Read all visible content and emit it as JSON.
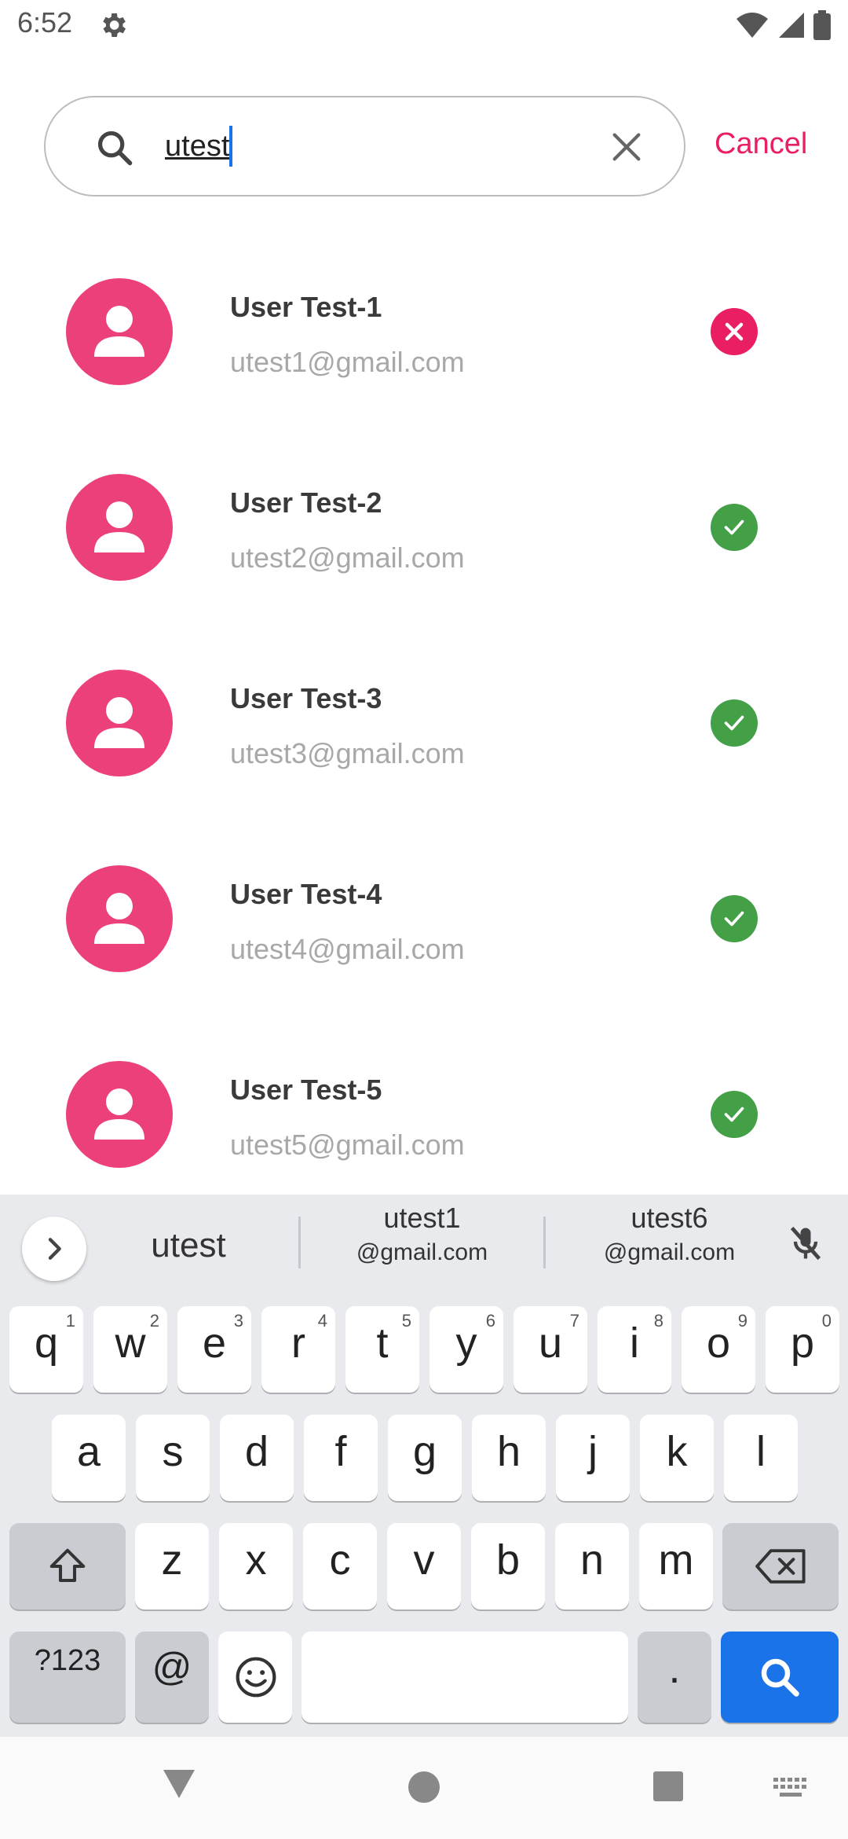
{
  "status_bar": {
    "time": "6:52"
  },
  "search": {
    "query": "utest",
    "cancel_label": "Cancel"
  },
  "contacts": [
    {
      "name": "User Test-1",
      "email": "utest1@gmail.com",
      "status": "error"
    },
    {
      "name": "User Test-2",
      "email": "utest2@gmail.com",
      "status": "ok"
    },
    {
      "name": "User Test-3",
      "email": "utest3@gmail.com",
      "status": "ok"
    },
    {
      "name": "User Test-4",
      "email": "utest4@gmail.com",
      "status": "ok"
    },
    {
      "name": "User Test-5",
      "email": "utest5@gmail.com",
      "status": "ok"
    }
  ],
  "colors": {
    "accent": "#e91e63",
    "avatar": "#ec407a",
    "ok": "#43a047",
    "key_action": "#1a73e8"
  },
  "keyboard": {
    "suggestions": [
      {
        "line1": "utest",
        "line2": ""
      },
      {
        "line1": "utest1",
        "line2": "@gmail.com"
      },
      {
        "line1": "utest6",
        "line2": "@gmail.com"
      }
    ],
    "row1": [
      {
        "ch": "q",
        "sup": "1"
      },
      {
        "ch": "w",
        "sup": "2"
      },
      {
        "ch": "e",
        "sup": "3"
      },
      {
        "ch": "r",
        "sup": "4"
      },
      {
        "ch": "t",
        "sup": "5"
      },
      {
        "ch": "y",
        "sup": "6"
      },
      {
        "ch": "u",
        "sup": "7"
      },
      {
        "ch": "i",
        "sup": "8"
      },
      {
        "ch": "o",
        "sup": "9"
      },
      {
        "ch": "p",
        "sup": "0"
      }
    ],
    "row2": [
      "a",
      "s",
      "d",
      "f",
      "g",
      "h",
      "j",
      "k",
      "l"
    ],
    "row3": [
      "z",
      "x",
      "c",
      "v",
      "b",
      "n",
      "m"
    ],
    "symbols_label": "?123",
    "at_label": "@",
    "period_label": ".",
    "icons": [
      "shift-icon",
      "backspace-icon",
      "emoji-icon",
      "search-icon",
      "mic-off-icon",
      "chevron-right-icon"
    ]
  },
  "nav_icons": [
    "back-icon",
    "home-icon",
    "recents-icon",
    "keyboard-switch-icon"
  ]
}
